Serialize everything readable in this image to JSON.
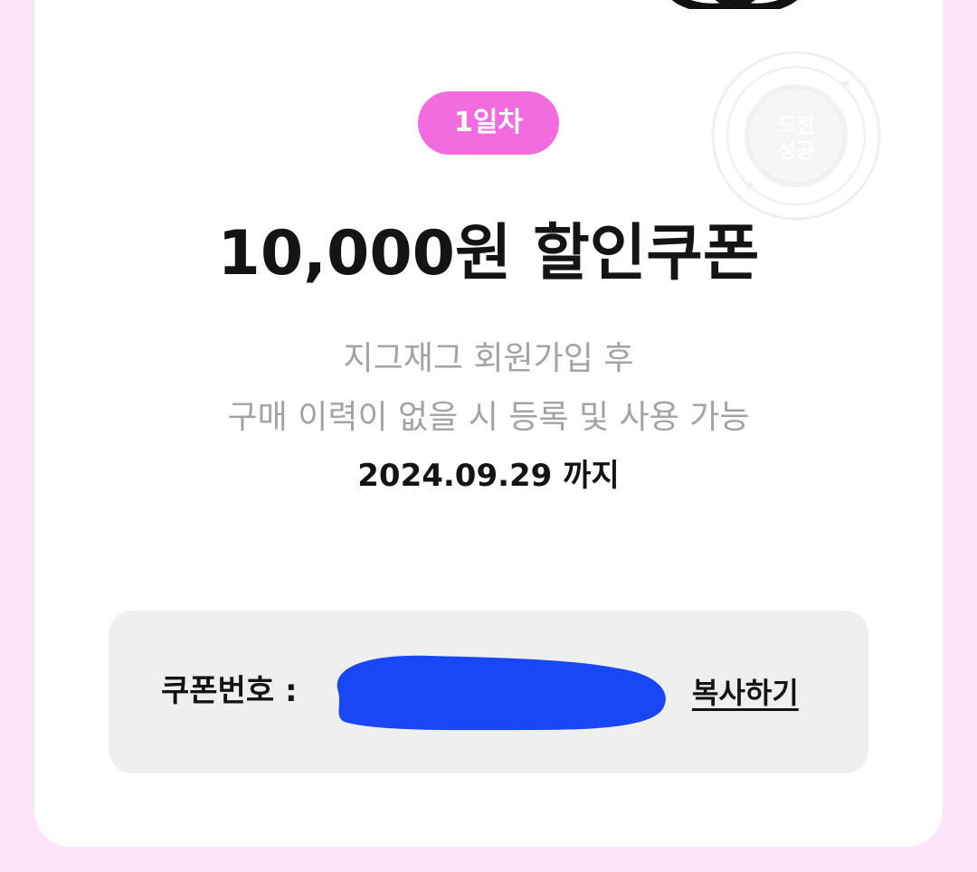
{
  "badge": {
    "day_label": "1일차"
  },
  "stamp": {
    "center_text": "도전 성공",
    "icon": "stamp-icon"
  },
  "coupon": {
    "title": "10,000원 할인쿠폰",
    "condition_line1": "지그재그 회원가입 후",
    "condition_line2": "구매 이력이 없을 시 등록 및 사용 가능",
    "expiry": "2024.09.29 까지"
  },
  "code_section": {
    "label": "쿠폰번호 :",
    "copy_label": "복사하기",
    "redaction_color": "#1a47f5"
  },
  "colors": {
    "badge": "#f26ce0",
    "background": "#fde4f8",
    "code_box": "#efefef"
  }
}
